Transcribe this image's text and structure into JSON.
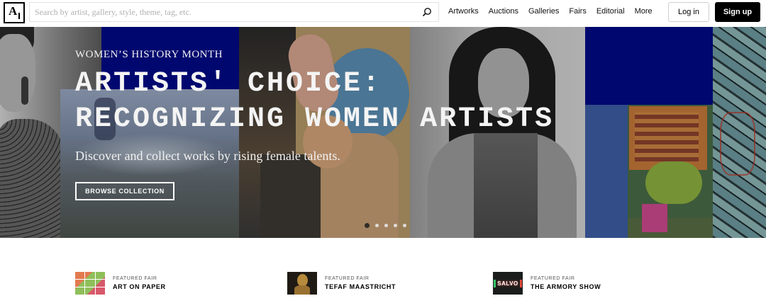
{
  "header": {
    "logo_letter": "A",
    "search_placeholder": "Search by artist, gallery, style, theme, tag, etc.",
    "nav": [
      "Artworks",
      "Auctions",
      "Galleries",
      "Fairs",
      "Editorial",
      "More"
    ],
    "login_label": "Log in",
    "signup_label": "Sign up"
  },
  "hero": {
    "overline": "WOMEN’S HISTORY MONTH",
    "title": "ARTISTS' CHOICE:\nRECOGNIZING WOMEN ARTISTS",
    "subtitle": "Discover and collect works by rising female talents.",
    "cta_label": "BROWSE COLLECTION",
    "slides_total": 5,
    "slide_active": 1
  },
  "featured": [
    {
      "kicker": "FEATURED FAIR",
      "name": "ART ON PAPER"
    },
    {
      "kicker": "FEATURED FAIR",
      "name": "TEFAF MAASTRICHT"
    },
    {
      "kicker": "FEATURED FAIR",
      "name": "THE ARMORY SHOW",
      "thumb_text": "SALVO"
    }
  ],
  "colors": {
    "brand_black": "#000000",
    "hero_blue": "#000a88",
    "text_white": "#f4f4f4"
  },
  "icons": {
    "search": "magnifier-icon",
    "logo": "artsy-logo-icon"
  }
}
